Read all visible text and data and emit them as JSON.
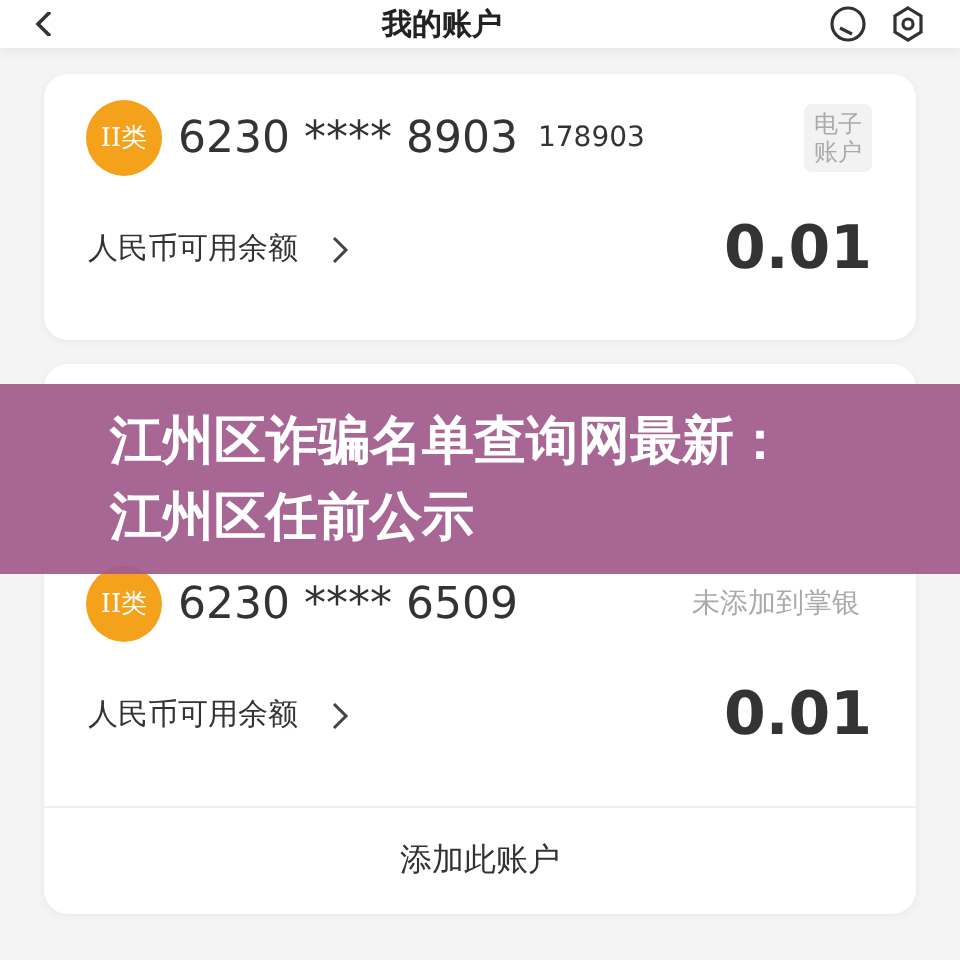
{
  "header": {
    "title": "我的账户"
  },
  "accounts": [
    {
      "badge": "II类",
      "number": "6230 **** 8903",
      "suffix": "178903",
      "tag": {
        "kind": "box",
        "text": "电子账户"
      },
      "balance_label": "人民币可用余额",
      "balance": "0.01"
    },
    {
      "badge": "II类",
      "number": "6230 **** 6509",
      "tag": {
        "kind": "note",
        "text": "未添加到掌银"
      },
      "balance_label": "人民币可用余额",
      "balance": "0.01",
      "action": "添加此账户"
    }
  ],
  "banner": {
    "lines": [
      "江州区诈骗名单查询网最新：",
      "江州区任前公示"
    ]
  }
}
